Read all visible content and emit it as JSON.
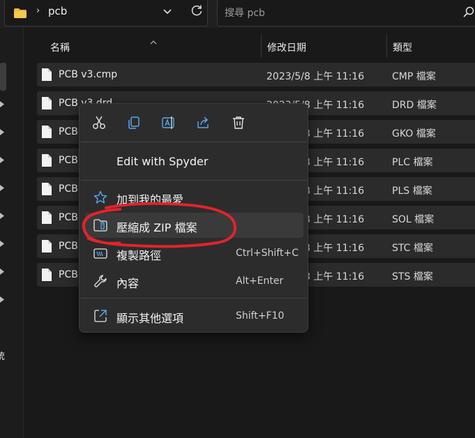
{
  "address_bar": {
    "current_folder": "pcb",
    "folder_icon": "folder-icon",
    "dropdown_icon": "chevron-down-icon",
    "refresh_icon": "refresh-icon"
  },
  "search": {
    "placeholder": "搜尋 pcb",
    "icon": "search-icon"
  },
  "columns": {
    "name": "名稱",
    "modified": "修改日期",
    "type": "類型"
  },
  "files": [
    {
      "name": "PCB v3.cmp",
      "date": "2023/5/8 上午 11:16",
      "type": "CMP 檔案"
    },
    {
      "name": "PCB v3.drd",
      "date": "2023/5/8 上午 11:16",
      "type": "DRD 檔案"
    },
    {
      "name": "PCB",
      "date": "2023/5/8 上午 11:16",
      "type": "GKO 檔案"
    },
    {
      "name": "PCB",
      "date": "2023/5/8 上午 11:16",
      "type": "PLC 檔案"
    },
    {
      "name": "PCB",
      "date": "2023/5/8 上午 11:16",
      "type": "PLS 檔案"
    },
    {
      "name": "PCB",
      "date": "2023/5/8 上午 11:16",
      "type": "SOL 檔案"
    },
    {
      "name": "PCB",
      "date": "2023/5/8 上午 11:16",
      "type": "STC 檔案"
    },
    {
      "name": "PCB",
      "date": "2023/5/8 上午 11:16",
      "type": "STS 檔案"
    }
  ],
  "nav_pane": {
    "truncated_label": "統"
  },
  "context_menu": {
    "quick_actions": [
      "cut-icon",
      "copy-icon",
      "rename-icon",
      "share-icon",
      "delete-icon"
    ],
    "items": {
      "spyder": {
        "label": "Edit with Spyder"
      },
      "favorites": {
        "label": "加到我的最愛",
        "icon": "star-icon"
      },
      "zip": {
        "label": "壓縮成 ZIP 檔案",
        "icon": "zip-folder-icon"
      },
      "copy_path": {
        "label": "複製路徑",
        "shortcut": "Ctrl+Shift+C",
        "icon": "copy-path-icon"
      },
      "properties": {
        "label": "內容",
        "shortcut": "Alt+Enter",
        "icon": "wrench-icon"
      },
      "more_options": {
        "label": "顯示其他選項",
        "shortcut": "Shift+F10",
        "icon": "open-external-icon"
      }
    },
    "highlight_color": "#e0242b"
  }
}
